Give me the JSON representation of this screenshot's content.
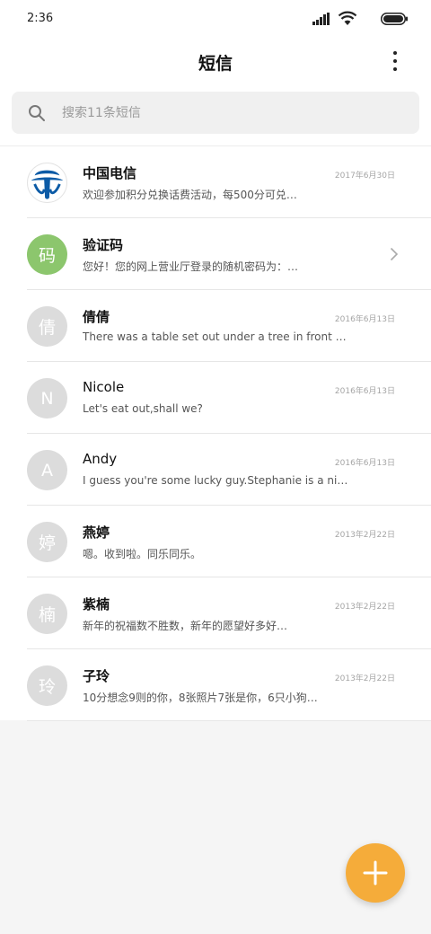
{
  "status_bar": {
    "time": "2:36",
    "icons": [
      "signal-icon",
      "wifi-icon",
      "battery-icon"
    ]
  },
  "header": {
    "title": "短信",
    "more_icon": "more-vertical-icon"
  },
  "search": {
    "placeholder": "搜索11条短信",
    "icon": "search-icon"
  },
  "messages": [
    {
      "name": "中国电信",
      "avatar_text": "",
      "avatar_type": "logo",
      "date": "2017年6月30日",
      "preview": "欢迎参加积分兑换话费活动，每500分可兑…"
    },
    {
      "name": "验证码",
      "avatar_text": "码",
      "avatar_type": "green",
      "date": "",
      "preview": "您好！您的网上营业厅登录的随机密码为：…",
      "has_chevron": true
    },
    {
      "name": "倩倩",
      "avatar_text": "倩",
      "avatar_type": "gray",
      "date": "2016年6月13日",
      "preview": "There was a table set out under a tree in front of the …"
    },
    {
      "name": "Nicole",
      "avatar_text": "N",
      "avatar_type": "gray",
      "date": "2016年6月13日",
      "preview": "Let's eat out,shall we?"
    },
    {
      "name": "Andy",
      "avatar_text": "A",
      "avatar_type": "gray",
      "date": "2016年6月13日",
      "preview": "I guess you're some lucky guy.Stephanie is a nice girl."
    },
    {
      "name": "燕婷",
      "avatar_text": "婷",
      "avatar_type": "gray",
      "date": "2013年2月22日",
      "preview": "嗯。收到啦。同乐同乐。"
    },
    {
      "name": "紫楠",
      "avatar_text": "楠",
      "avatar_type": "gray",
      "date": "2013年2月22日",
      "preview": "新年的祝福数不胜数，新年的愿望好多好…"
    },
    {
      "name": "子玲",
      "avatar_text": "玲",
      "avatar_type": "gray",
      "date": "2013年2月22日",
      "preview": "10分想念9则的你，8张照片7张是你，6只小狗…"
    }
  ],
  "fab": {
    "icon": "plus-icon"
  },
  "colors": {
    "accent": "#f5ac3a",
    "verification_avatar": "#8cc66d",
    "default_avatar": "#dcdcdc",
    "telecom_blue": "#0c5ba6"
  }
}
